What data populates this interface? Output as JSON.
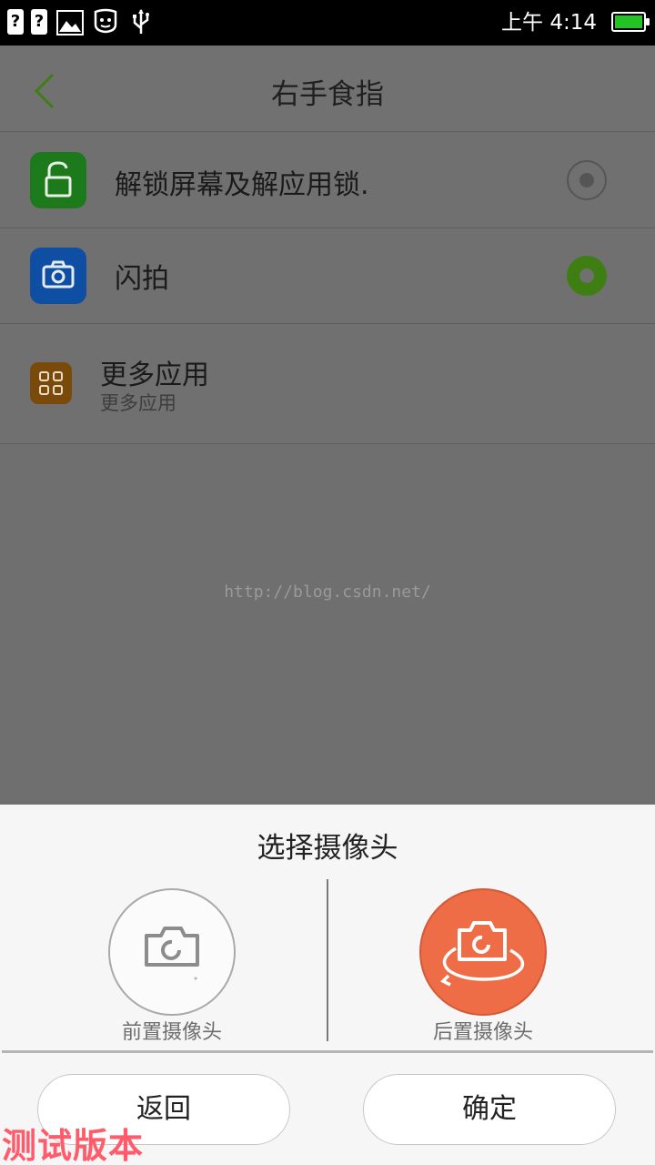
{
  "status_bar": {
    "time": "上午 4:14",
    "notification_icons": [
      "unknown-notification-icon",
      "unknown-notification-icon",
      "gallery-icon",
      "face-app-icon",
      "usb-icon"
    ],
    "unknown_glyph": "?"
  },
  "header": {
    "title": "右手食指"
  },
  "list": {
    "items": [
      {
        "title": "解锁屏幕及解应用锁.",
        "icon": "unlock-icon",
        "selected": false
      },
      {
        "title": "闪拍",
        "icon": "camera-icon",
        "selected": true
      },
      {
        "title": "更多应用",
        "subtitle": "更多应用",
        "icon": "apps-grid-icon"
      }
    ]
  },
  "watermark": "http://blog.csdn.net/",
  "dialog": {
    "title": "选择摄像头",
    "options": [
      {
        "label": "前置摄像头",
        "icon": "front-camera-icon",
        "selected": false
      },
      {
        "label": "后置摄像头",
        "icon": "rear-camera-icon",
        "selected": true
      }
    ],
    "back_label": "返回",
    "confirm_label": "确定"
  },
  "colors": {
    "accent_green": "#3f7e12",
    "rear_camera_orange": "#ee6c46",
    "battery_green": "#22c322"
  },
  "test_badge": "测试版本"
}
